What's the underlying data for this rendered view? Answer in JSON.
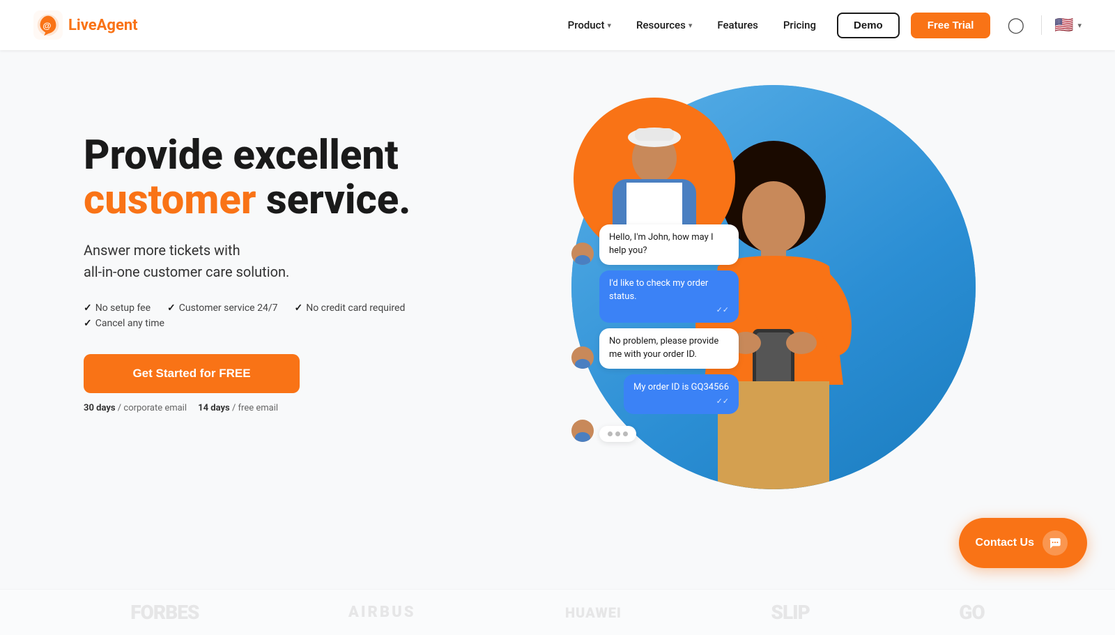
{
  "brand": {
    "name_part1": "Live",
    "name_part2": "Agent",
    "logo_alt": "LiveAgent logo"
  },
  "nav": {
    "links": [
      {
        "label": "Product",
        "has_dropdown": true
      },
      {
        "label": "Resources",
        "has_dropdown": true
      },
      {
        "label": "Features",
        "has_dropdown": false
      },
      {
        "label": "Pricing",
        "has_dropdown": false
      }
    ],
    "demo_label": "Demo",
    "free_trial_label": "Free Trial",
    "language": "EN"
  },
  "hero": {
    "title_line1": "Provide excellent",
    "title_highlight": "customer",
    "title_line2": "service.",
    "subtitle": "Answer more tickets with\nall-in-one customer care solution.",
    "checks": [
      "No setup fee",
      "Customer service 24/7",
      "No credit card required",
      "Cancel any time"
    ],
    "cta_label": "Get Started for FREE",
    "trial_note_1_days": "30 days",
    "trial_note_1_text": "/ corporate email",
    "trial_note_2_days": "14 days",
    "trial_note_2_text": "/ free email"
  },
  "chat": {
    "messages": [
      {
        "type": "agent",
        "text": "Hello, I'm John, how may I help you?"
      },
      {
        "type": "user",
        "text": "I'd like to check my order status."
      },
      {
        "type": "agent",
        "text": "No problem, please provide me with your order ID."
      },
      {
        "type": "user",
        "text": "My order ID is GQ34566"
      }
    ],
    "typing": true
  },
  "logos": [
    "Forbes",
    "AIRBUS",
    "HUAWEI",
    "SLIP",
    "Go"
  ],
  "contact_us": {
    "label": "Contact Us"
  }
}
